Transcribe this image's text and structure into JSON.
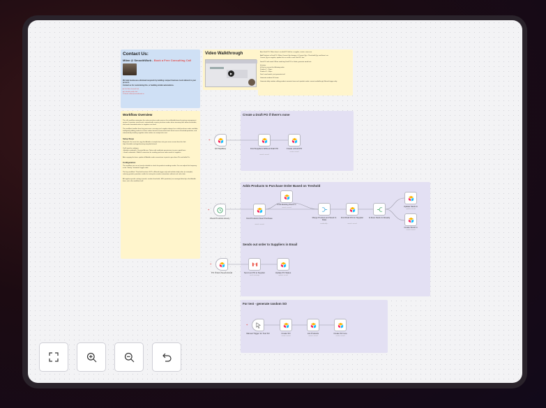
{
  "contact": {
    "title": "Contact Us:",
    "author": "Milan @ SmoothWork - ",
    "cta": "Book a Free Consulting Call",
    "blurb": "We help businesses eliminate busywork by building compact business tools tailored to your process.",
    "blurb2": "Contact us for customizing this, or building similar automations.",
    "links": [
      "▶ YouTube channel link",
      "◉ LinkedIn profile link",
      "✉ Email: milan@smoothwork.ai"
    ]
  },
  "video": {
    "title": "Video Walkthrough"
  },
  "setup_note": [
    "Auto Draft PO: When there's no draft PO left for a supplier, create a new one.",
    "Add Products to Draft PO: When Current Qty changes, if Current Qty < Threshold Qty, and there's no",
    "Current Qty on supplier, update this or create a new Draft PO line.",
    "Send PO with email: When switching Draft PO to Order, generate email text.",
    "Id status",
    "Id Set to reserve the following order:",
    "Product Y - 15pcs",
    "Product X - 10pcs",
    "Don't send emails, just generate text!",
    "Generate random SO items",
    "Generate daily random selling product amounts from each product under current available qty. Manual trigger only."
  ],
  "overview": {
    "title": "Workflow Overview",
    "paras": [
      "This n8n workflow automates the entire purchase order process for an Airtable-based inventory management system. It monitors stock levels, automatically creates purchase orders when inventory falls below thresholds, and sends formatted orders to suppliers via email.",
      "The workflow handles three key processes: ensuring each supplier always has a draft purchase order available, intelligently adding products to those orders based on forecasted stock levels versus threshold quantities, and automatically emailing suppliers when orders are ready to be sent.",
      "Setup Steps",
      "Required: You must first copy the Airtable at sample base into your own account from this link: https://airtable.com/app/inventory-template/shared",
      "You'll need to configure:",
      "• Airtable credentials: Personal Access Token with read/write permissions to your copied base",
      "• Gmail credentials: OAuth2 connection for sending purchase order emails to suppliers",
      "After copying the base, update all Airtable node connections to point to your base IDs and table IDs.",
      "Configuration",
      "The workflow runs on an hourly schedule to check for products needing reorder. You can adjust this frequency in the \"Hourly\" Schedule Trigger node.",
      "The key workflow / Threshold sections SUT in Manual trigger only and includes daily sales (or example) reducing product quantities usable for testing the reorder automations without real sales data.",
      "All supplier-specific settings (emails, reorder thresholds, SKU quantities) are managed directly in the Airtable base, not in the workflow itself."
    ]
  },
  "groups": {
    "draft_po": {
      "title": "Create a Draft PO if there's none",
      "nodes": [
        {
          "label": "PO Modified",
          "sub": ""
        },
        {
          "label": "Find Suppliers Without Draft PO",
          "sub": "search: record"
        },
        {
          "label": "Create a Draft PO",
          "sub": "create: record"
        }
      ]
    },
    "add_products": {
      "title": "Adds Products to Purchase Order Based on Treshold",
      "nodes": [
        {
          "label": "Check Products Hourly",
          "sub": ""
        },
        {
          "label": "Find Products Need Purchase",
          "sub": "search: record"
        },
        {
          "label": "Find Existing Stock In",
          "sub": "search: record"
        },
        {
          "label": "Merge Product and Stock In Data",
          "sub": "combineBy..."
        },
        {
          "label": "Find Draft PO for Supplier",
          "sub": "search: record"
        },
        {
          "label": "Is there Stock In Already",
          "sub": ""
        },
        {
          "label": "Update Stock In",
          "sub": "update: record"
        },
        {
          "label": "Create Stock In",
          "sub": "create: record"
        }
      ]
    },
    "send_email": {
      "title": "Sends out order to Suppliers in Email",
      "nodes": [
        {
          "label": "PO Orders Needs Email",
          "sub": ""
        },
        {
          "label": "Send out PO to Supplier",
          "sub": "send: message"
        },
        {
          "label": "Update PO Status",
          "sub": "update: record"
        }
      ]
    },
    "test_so": {
      "title": "For test - generate random SO",
      "nodes": [
        {
          "label": "Manual Trigger for Test SO",
          "sub": ""
        },
        {
          "label": "Create SO",
          "sub": "create: record"
        },
        {
          "label": "List Products",
          "sub": "search: record"
        },
        {
          "label": "Create SO Line",
          "sub": "create: record"
        }
      ]
    }
  },
  "controls": [
    "fit-view",
    "zoom-in",
    "zoom-out",
    "undo"
  ],
  "colors": {
    "airtable_red": "#f82b60",
    "airtable_yellow": "#fcb400",
    "airtable_blue": "#18bfff",
    "gmail_red": "#ea4335",
    "trigger_green": "#2e9e5b",
    "link_red": "#e3524f"
  }
}
